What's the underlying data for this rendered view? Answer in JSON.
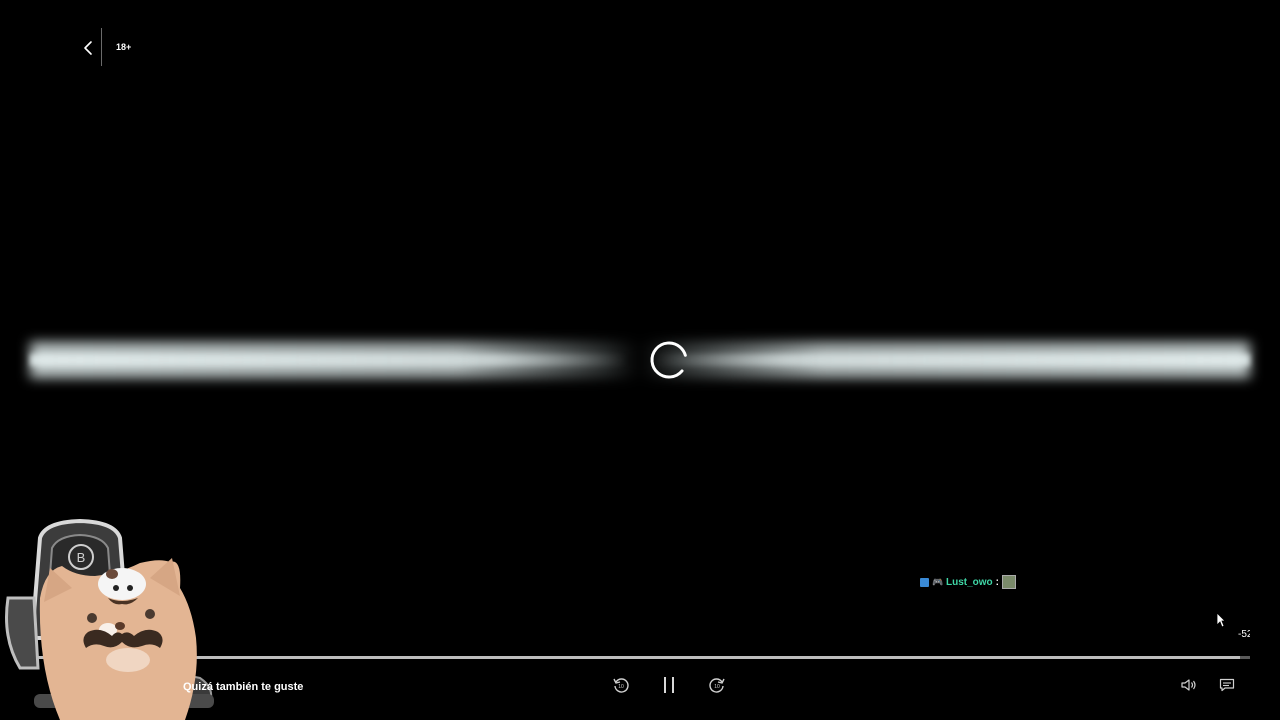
{
  "top": {
    "rating": "18+"
  },
  "player": {
    "progress_fraction": 0.992,
    "time_remaining": "-52",
    "suggest_label": "Quizá también te guste"
  },
  "chat": {
    "username": "Lust_owo",
    "separator": ":"
  },
  "icons": {
    "back": "chevron-left-icon",
    "spinner": "loading-spinner-icon",
    "rewind": "rewind-10-icon",
    "pause": "pause-icon",
    "forward": "forward-10-icon",
    "volume": "volume-icon",
    "subtitles": "subtitles-icon",
    "cursor": "mouse-pointer-icon"
  },
  "colors": {
    "background": "#000000",
    "chat_username": "#3fd6a6",
    "progress_track": "#5a5a5a",
    "progress_fill": "#bdbdbd"
  }
}
